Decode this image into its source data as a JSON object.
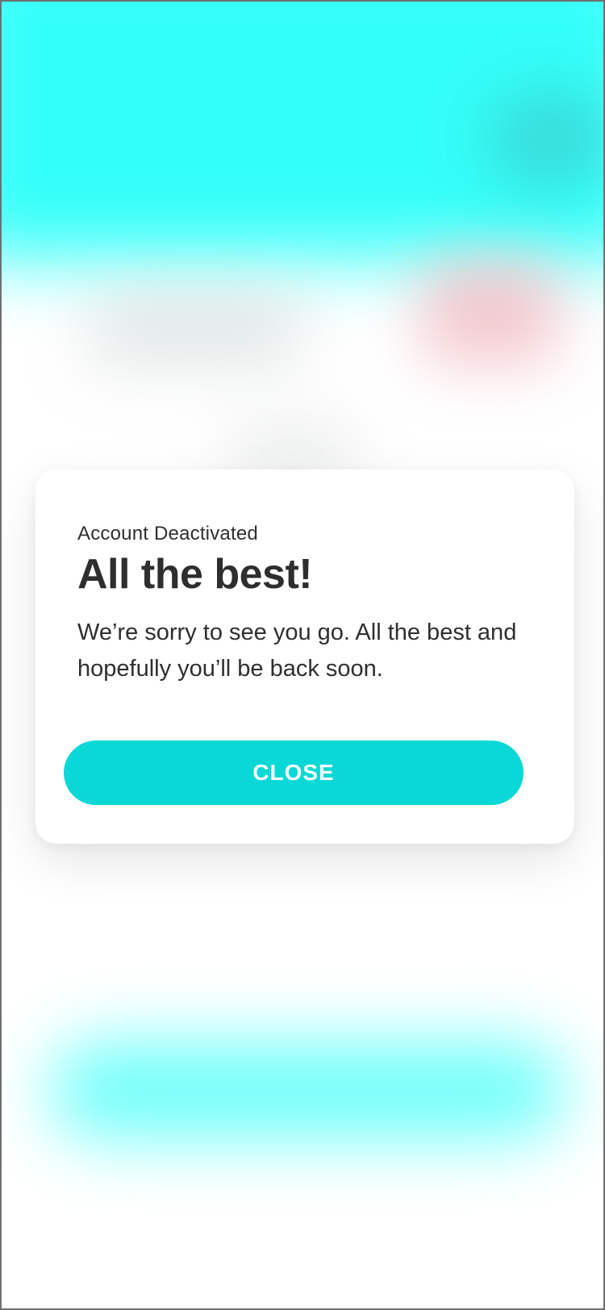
{
  "dialog": {
    "subtitle": "Account Deactivated",
    "title": "All the best!",
    "message": "We’re sorry to see you go. All the best and hopefully you’ll be back soon.",
    "close_label": "CLOSE"
  },
  "colors": {
    "accent": "#09D8D6",
    "header_background": "#33FFF9",
    "text": "#2F2F2F",
    "surface": "#FFFFFF"
  }
}
